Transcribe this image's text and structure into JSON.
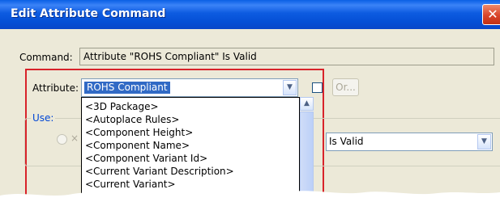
{
  "window": {
    "title": "Edit Attribute Command",
    "close_glyph": "✕"
  },
  "command": {
    "label": "Command:",
    "value": "Attribute \"ROHS Compliant\" Is Valid"
  },
  "attribute": {
    "label": "Attribute:",
    "selected": "ROHS Compliant",
    "arrow_icon": "chevron-down-icon"
  },
  "or_button": {
    "label": "Or..."
  },
  "use": {
    "label": "Use:"
  },
  "condition": {
    "value": "Is Valid"
  },
  "dropdown": {
    "items": [
      "<3D Package>",
      "<Autoplace Rules>",
      "<Component Height>",
      "<Component Name>",
      "<Component Variant Id>",
      "<Current Variant Description>",
      "<Current Variant>"
    ]
  },
  "colors": {
    "titlebar": "#0a5fe5",
    "highlight": "#316ac5",
    "frame_highlight": "#d8232a",
    "dialog_bg": "#ece9d8"
  }
}
